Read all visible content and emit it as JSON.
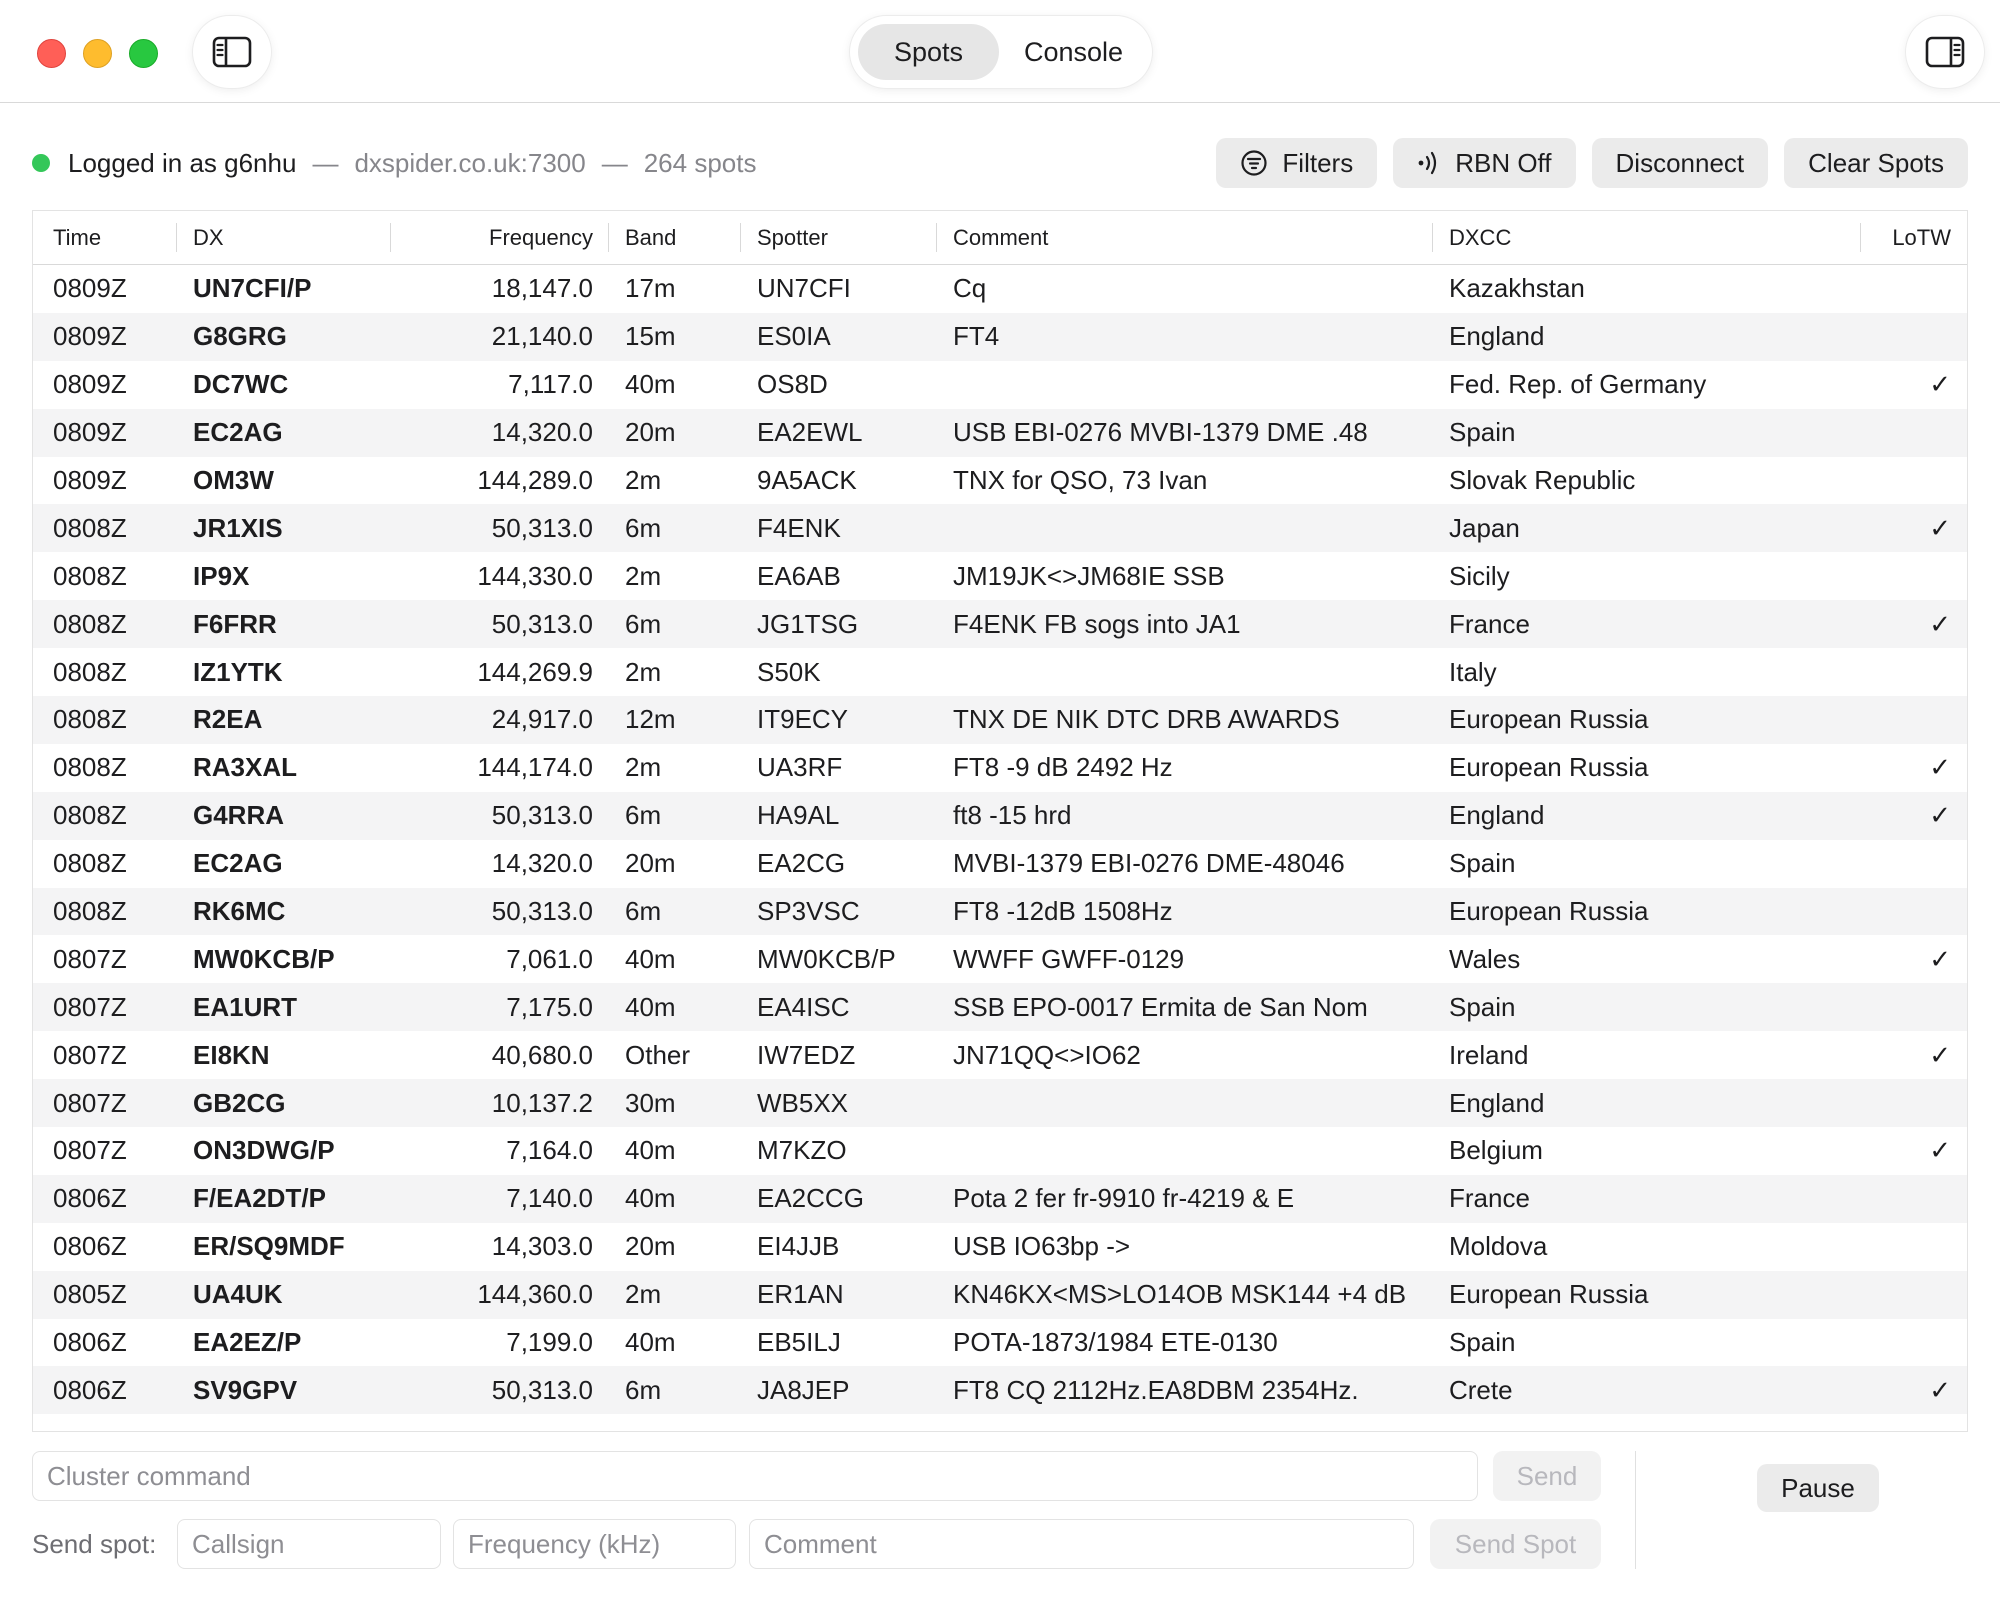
{
  "titlebar": {
    "tabs": [
      {
        "label": "Spots",
        "active": true
      },
      {
        "label": "Console",
        "active": false
      }
    ]
  },
  "status": {
    "logged_in": "Logged in as g6nhu",
    "separator": "—",
    "server": "dxspider.co.uk:7300",
    "spot_count": "264 spots",
    "indicator_color": "#34c759"
  },
  "toolbar": {
    "filters_label": "Filters",
    "rbn_label": "RBN Off",
    "disconnect_label": "Disconnect",
    "clear_label": "Clear Spots"
  },
  "table": {
    "columns": [
      "Time",
      "DX",
      "Frequency",
      "Band",
      "Spotter",
      "Comment",
      "DXCC",
      "LoTW"
    ],
    "rows": [
      {
        "time": "0809Z",
        "dx": "UN7CFI/P",
        "freq": "18,147.0",
        "band": "17m",
        "spotter": "UN7CFI",
        "comment": "Cq",
        "dxcc": "Kazakhstan",
        "lotw": ""
      },
      {
        "time": "0809Z",
        "dx": "G8GRG",
        "freq": "21,140.0",
        "band": "15m",
        "spotter": "ES0IA",
        "comment": "FT4",
        "dxcc": "England",
        "lotw": ""
      },
      {
        "time": "0809Z",
        "dx": "DC7WC",
        "freq": "7,117.0",
        "band": "40m",
        "spotter": "OS8D",
        "comment": "",
        "dxcc": "Fed. Rep. of Germany",
        "lotw": "✓"
      },
      {
        "time": "0809Z",
        "dx": "EC2AG",
        "freq": "14,320.0",
        "band": "20m",
        "spotter": "EA2EWL",
        "comment": "USB EBI-0276 MVBI-1379 DME .48",
        "dxcc": "Spain",
        "lotw": ""
      },
      {
        "time": "0809Z",
        "dx": "OM3W",
        "freq": "144,289.0",
        "band": "2m",
        "spotter": "9A5ACK",
        "comment": "TNX for QSO, 73 Ivan",
        "dxcc": "Slovak Republic",
        "lotw": ""
      },
      {
        "time": "0808Z",
        "dx": "JR1XIS",
        "freq": "50,313.0",
        "band": "6m",
        "spotter": "F4ENK",
        "comment": "",
        "dxcc": "Japan",
        "lotw": "✓"
      },
      {
        "time": "0808Z",
        "dx": "IP9X",
        "freq": "144,330.0",
        "band": "2m",
        "spotter": "EA6AB",
        "comment": "JM19JK<>JM68IE SSB",
        "dxcc": "Sicily",
        "lotw": ""
      },
      {
        "time": "0808Z",
        "dx": "F6FRR",
        "freq": "50,313.0",
        "band": "6m",
        "spotter": "JG1TSG",
        "comment": "F4ENK FB sogs into JA1",
        "dxcc": "France",
        "lotw": "✓"
      },
      {
        "time": "0808Z",
        "dx": "IZ1YTK",
        "freq": "144,269.9",
        "band": "2m",
        "spotter": "S50K",
        "comment": "",
        "dxcc": "Italy",
        "lotw": ""
      },
      {
        "time": "0808Z",
        "dx": "R2EA",
        "freq": "24,917.0",
        "band": "12m",
        "spotter": "IT9ECY",
        "comment": "TNX DE NIK DTC DRB AWARDS",
        "dxcc": "European Russia",
        "lotw": ""
      },
      {
        "time": "0808Z",
        "dx": "RA3XAL",
        "freq": "144,174.0",
        "band": "2m",
        "spotter": "UA3RF",
        "comment": "FT8 -9 dB 2492 Hz",
        "dxcc": "European Russia",
        "lotw": "✓"
      },
      {
        "time": "0808Z",
        "dx": "G4RRA",
        "freq": "50,313.0",
        "band": "6m",
        "spotter": "HA9AL",
        "comment": "ft8 -15 hrd",
        "dxcc": "England",
        "lotw": "✓"
      },
      {
        "time": "0808Z",
        "dx": "EC2AG",
        "freq": "14,320.0",
        "band": "20m",
        "spotter": "EA2CG",
        "comment": "MVBI-1379 EBI-0276 DME-48046",
        "dxcc": "Spain",
        "lotw": ""
      },
      {
        "time": "0808Z",
        "dx": "RK6MC",
        "freq": "50,313.0",
        "band": "6m",
        "spotter": "SP3VSC",
        "comment": "FT8 -12dB 1508Hz",
        "dxcc": "European Russia",
        "lotw": ""
      },
      {
        "time": "0807Z",
        "dx": "MW0KCB/P",
        "freq": "7,061.0",
        "band": "40m",
        "spotter": "MW0KCB/P",
        "comment": "WWFF GWFF-0129",
        "dxcc": "Wales",
        "lotw": "✓"
      },
      {
        "time": "0807Z",
        "dx": "EA1URT",
        "freq": "7,175.0",
        "band": "40m",
        "spotter": "EA4ISC",
        "comment": "SSB EPO-0017 Ermita de San Nom",
        "dxcc": "Spain",
        "lotw": ""
      },
      {
        "time": "0807Z",
        "dx": "EI8KN",
        "freq": "40,680.0",
        "band": "Other",
        "spotter": "IW7EDZ",
        "comment": "JN71QQ<>IO62",
        "dxcc": "Ireland",
        "lotw": "✓"
      },
      {
        "time": "0807Z",
        "dx": "GB2CG",
        "freq": "10,137.2",
        "band": "30m",
        "spotter": "WB5XX",
        "comment": "",
        "dxcc": "England",
        "lotw": ""
      },
      {
        "time": "0807Z",
        "dx": "ON3DWG/P",
        "freq": "7,164.0",
        "band": "40m",
        "spotter": "M7KZO",
        "comment": "",
        "dxcc": "Belgium",
        "lotw": "✓"
      },
      {
        "time": "0806Z",
        "dx": "F/EA2DT/P",
        "freq": "7,140.0",
        "band": "40m",
        "spotter": "EA2CCG",
        "comment": "Pota 2 fer fr-9910 fr-4219 & E",
        "dxcc": "France",
        "lotw": ""
      },
      {
        "time": "0806Z",
        "dx": "ER/SQ9MDF",
        "freq": "14,303.0",
        "band": "20m",
        "spotter": "EI4JJB",
        "comment": "USB IO63bp ->",
        "dxcc": "Moldova",
        "lotw": ""
      },
      {
        "time": "0805Z",
        "dx": "UA4UK",
        "freq": "144,360.0",
        "band": "2m",
        "spotter": "ER1AN",
        "comment": "KN46KX<MS>LO14OB MSK144 +4 dB",
        "dxcc": "European Russia",
        "lotw": ""
      },
      {
        "time": "0806Z",
        "dx": "EA2EZ/P",
        "freq": "7,199.0",
        "band": "40m",
        "spotter": "EB5ILJ",
        "comment": "POTA-1873/1984 ETE-0130",
        "dxcc": "Spain",
        "lotw": ""
      },
      {
        "time": "0806Z",
        "dx": "SV9GPV",
        "freq": "50,313.0",
        "band": "6m",
        "spotter": "JA8JEP",
        "comment": "FT8 CQ 2112Hz.EA8DBM 2354Hz.",
        "dxcc": "Crete",
        "lotw": "✓"
      }
    ]
  },
  "command": {
    "placeholder": "Cluster command",
    "send_label": "Send",
    "pause_label": "Pause"
  },
  "send_spot": {
    "label": "Send spot:",
    "callsign_placeholder": "Callsign",
    "frequency_placeholder": "Frequency (kHz)",
    "comment_placeholder": "Comment",
    "button_label": "Send Spot"
  }
}
